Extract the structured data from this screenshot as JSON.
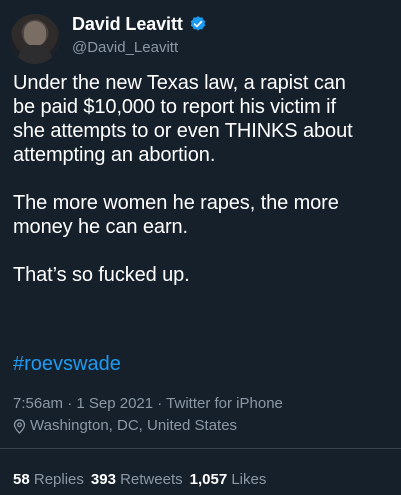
{
  "tweet": {
    "author": {
      "display_name": "David Leavitt",
      "handle": "@David_Leavitt",
      "verified": true,
      "avatar_icon": "avatar-photo"
    },
    "paragraphs": [
      "Under the new Texas law, a rapist can\nbe paid $10,000 to report his victim if\nshe attempts to or even THINKS about\nattempting an abortion.",
      "The more women he rapes, the more\nmoney he can earn.",
      "That’s so fucked up."
    ],
    "hashtag": "#roevswade",
    "timestamp": "7:56am · 1 Sep 2021 · Twitter for iPhone",
    "location": "Washington, DC, United States",
    "stats": {
      "replies_count": "58",
      "replies_label": "Replies",
      "retweets_count": "393",
      "retweets_label": "Retweets",
      "likes_count": "1,057",
      "likes_label": "Likes"
    },
    "colors": {
      "background": "#15202b",
      "accent": "#1d9bf0",
      "secondary_text": "#8b98a5",
      "divider": "#38444d"
    }
  }
}
